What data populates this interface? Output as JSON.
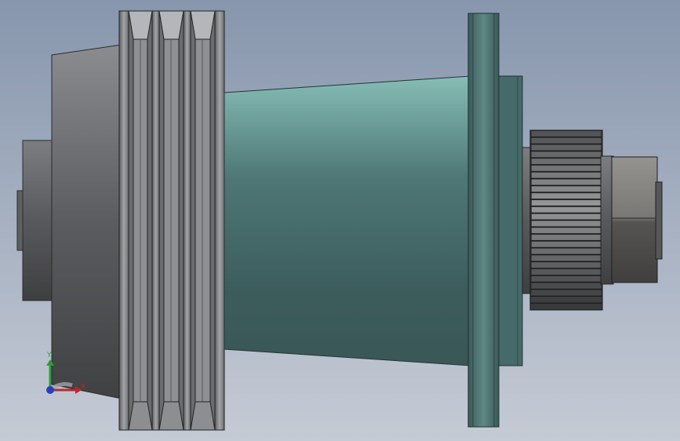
{
  "viewport": {
    "colors": {
      "background_top": "#8796ad",
      "background_bottom": "#c4cad4",
      "teal_light": "#7fb5ae",
      "teal_dark": "#355352",
      "metal_light": "#9a9c9f",
      "metal_dark": "#3c3e40"
    }
  },
  "triad": {
    "x_label": "X",
    "y_label": "Y",
    "x_color": "#c0262b",
    "y_color": "#2e9b3a",
    "z_color": "#2a3fbf"
  }
}
